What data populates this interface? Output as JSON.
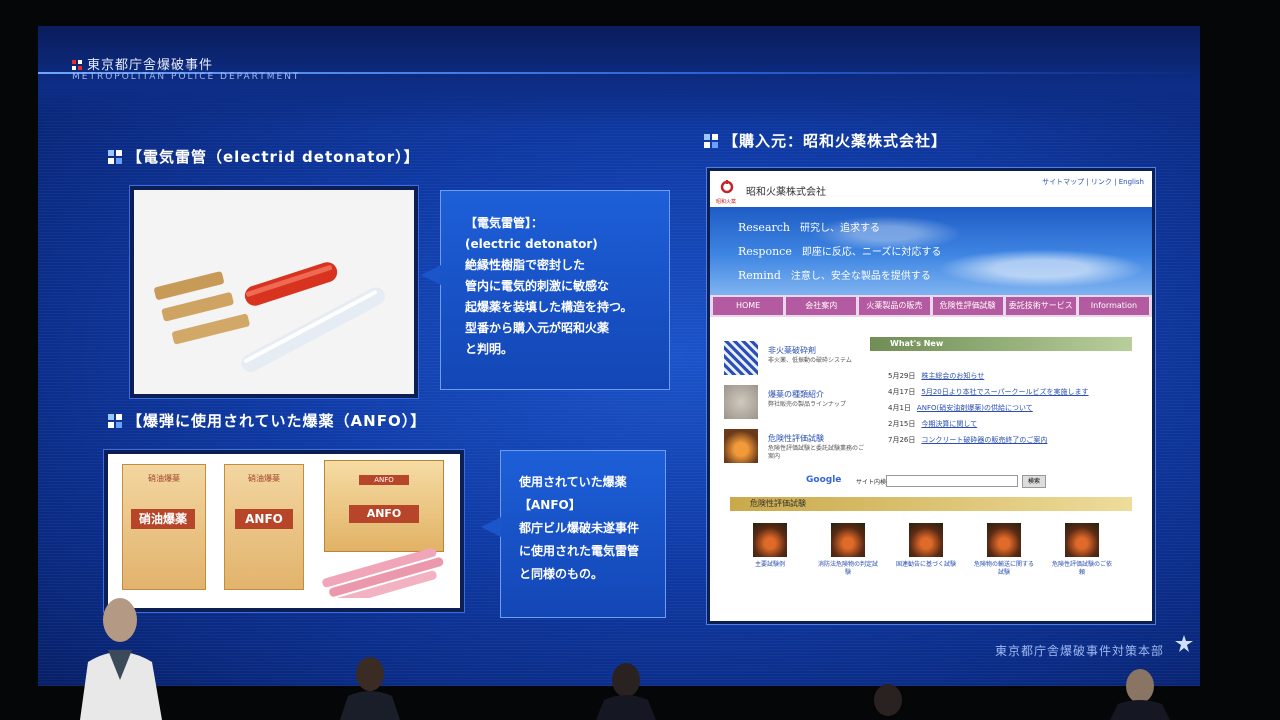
{
  "header": {
    "title": "東京都庁舎爆破事件",
    "subtitle": "METROPOLITAN POLICE DEPARTMENT"
  },
  "sections": {
    "detonator_title": "【電気雷管（electrid detonator）】",
    "anfo_title": "【爆弾に使用されていた爆薬（ANFO）】",
    "source_title": "【購入元：昭和火薬株式会社】"
  },
  "callouts": {
    "detonator_lines": [
      "【電気雷管】：",
      "(electric detonator)",
      "絶縁性樹脂で密封した",
      "管内に電気的刺激に敏感な",
      "起爆薬を装填した構造を持つ。",
      "型番から購入元が昭和火薬",
      "と判明。"
    ],
    "anfo_lines": [
      "使用されていた爆薬",
      "【ANFO】",
      "都庁ビル爆破未遂事件",
      "に使用された電気雷管",
      "と同様のもの。"
    ]
  },
  "anfo_photo": {
    "bag1_label": "硝油爆薬",
    "bag1_top": "硝油爆薬",
    "bag2_label": "ANFO",
    "bag2_top": "硝油爆薬",
    "box_top": "ANFO",
    "box_label": "ANFO"
  },
  "website": {
    "company_name": "昭和火薬株式会社",
    "logo_caption": "昭和火薬",
    "top_links": "サイトマップ | リンク | English",
    "taglines": [
      {
        "word": "Research",
        "text": "研究し、追求する"
      },
      {
        "word": "Responce",
        "text": "即座に反応、ニーズに対応する"
      },
      {
        "word": "Remind",
        "text": "注意し、安全な製品を提供する"
      }
    ],
    "nav": [
      "HOME",
      "会社案内",
      "火薬製品の販売",
      "危険性評価試験",
      "委託技術サービス",
      "Information"
    ],
    "side_items": [
      {
        "title": "非火薬破砕剤",
        "desc": "非火薬、低振動の破砕システム"
      },
      {
        "title": "爆薬の種類紹介",
        "desc": "弊社販売の製品ラインナップ"
      },
      {
        "title": "危険性評価試験",
        "desc": "危険性評価試験と委託試験業務のご案内"
      }
    ],
    "whats_new_label": "What's New",
    "news": [
      {
        "date": "5月29日",
        "text": "株主総会のお知らせ"
      },
      {
        "date": "4月17日",
        "text": "5月20日より本社でスーパークールビズを実施します"
      },
      {
        "date": "4月1日",
        "text": "ANFO(硝安油剤爆薬)の供給について"
      },
      {
        "date": "2月15日",
        "text": "今期決算に関して"
      },
      {
        "date": "7月26日",
        "text": "コンクリート破砕器の販売終了のご案内"
      }
    ],
    "google_label": "Google",
    "search_label": "サイト内検索",
    "search_button": "検索",
    "eval_heading": "危険性評価試験",
    "eval_items": [
      "主要試験例",
      "消防法危険物の判定試験",
      "国連勧告に基づく試験",
      "危険物の輸送に関する試験",
      "危険性評価試験のご依頼"
    ]
  },
  "footer": {
    "text": "東京都庁舎爆破事件対策本部"
  }
}
